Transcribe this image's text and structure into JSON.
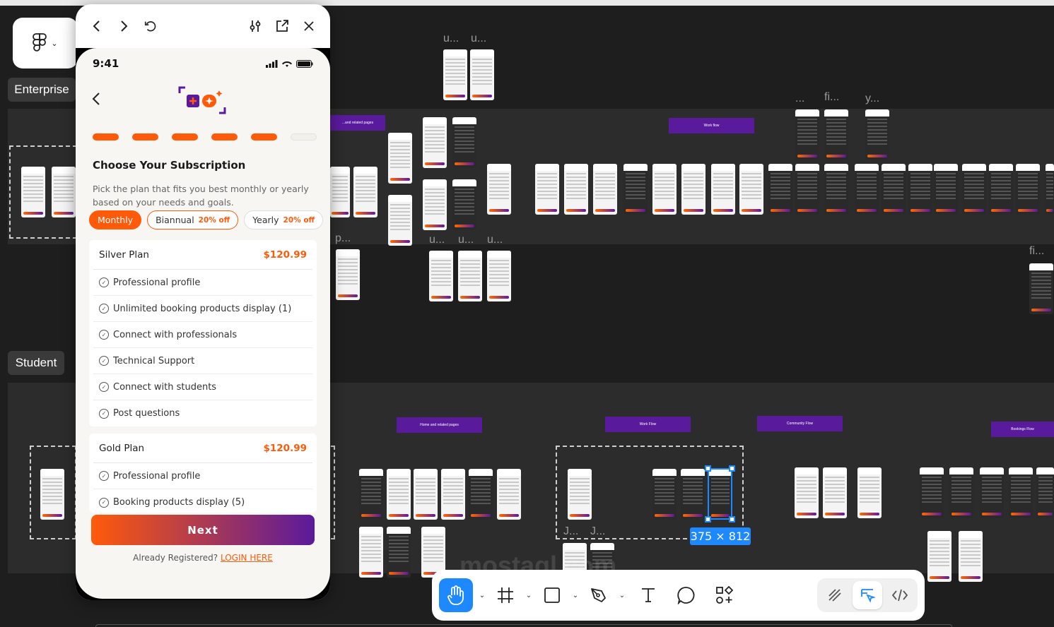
{
  "canvas": {
    "section_labels": [
      "Enterprise",
      "Student"
    ],
    "flow_labels": {
      "home_top": "...and related pages",
      "work_top": "Work flow",
      "home_bottom": "Home and related pages",
      "work_bottom": "Work Flow",
      "community": "Community Flow",
      "bookings": "Bookings Flow"
    },
    "frame_labels": [
      "u...",
      "u...",
      "...",
      "fi...",
      "y...",
      "p...",
      "u...",
      "u...",
      "u...",
      "fi...",
      "J...",
      "J..."
    ],
    "selection_size": "375 × 812",
    "watermark": "mostaql.com"
  },
  "preview": {
    "status_time": "9:41",
    "title": "Choose Your Subscription",
    "subtitle": "Pick the plan that fits you best monthly or yearly based on your needs and goals.",
    "progress_total": 6,
    "progress_done": 5,
    "tabs": [
      {
        "label": "Monthly",
        "off": ""
      },
      {
        "label": "Biannual",
        "off": "20% off"
      },
      {
        "label": "Yearly",
        "off": "20% off"
      }
    ],
    "plans": [
      {
        "name": "Silver Plan",
        "price": "$120.99",
        "features": [
          "Professional profile",
          "Unlimited booking products display (1)",
          "Connect with professionals",
          "Technical Support",
          "Connect with students",
          "Post questions"
        ]
      },
      {
        "name": "Gold Plan",
        "price": "$120.99",
        "features": [
          "Professional profile",
          "Booking products display (5)"
        ]
      }
    ],
    "next_label": "Next",
    "login_prompt": "Already Registered?",
    "login_link": "LOGIN HERE"
  },
  "colors": {
    "accent": "#ff5a0a",
    "brand_purple": "#5a1a9c",
    "figma_blue": "#1e88ff"
  }
}
